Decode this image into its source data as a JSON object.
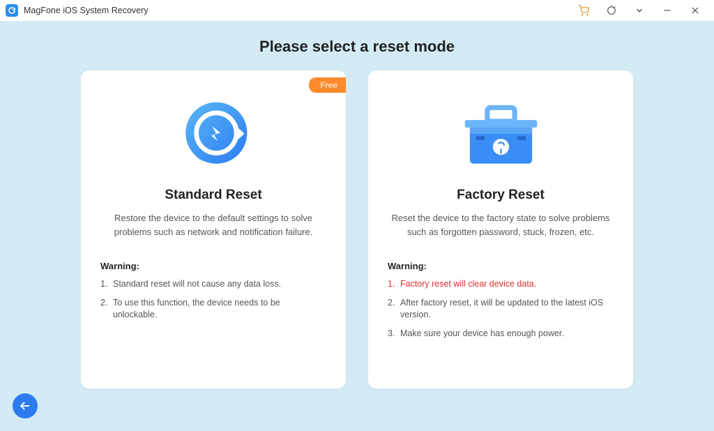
{
  "app": {
    "title": "MagFone iOS System Recovery"
  },
  "page": {
    "heading": "Please select a reset mode"
  },
  "cards": {
    "standard": {
      "badge": "Free",
      "title": "Standard Reset",
      "description": "Restore the device to the default settings to solve problems such as network and notification failure.",
      "warning_title": "Warning:",
      "warnings": [
        "Standard reset will not cause any data loss.",
        "To use this function, the device needs to be unlockable."
      ]
    },
    "factory": {
      "title": "Factory Reset",
      "description": "Reset the device to the factory state to solve problems such as forgotten password, stuck, frozen, etc.",
      "warning_title": "Warning:",
      "warnings": [
        "Factory reset will clear device data.",
        "After factory reset, it will be updated to the latest iOS version.",
        "Make sure your device has enough power."
      ],
      "danger_index": 0
    }
  }
}
